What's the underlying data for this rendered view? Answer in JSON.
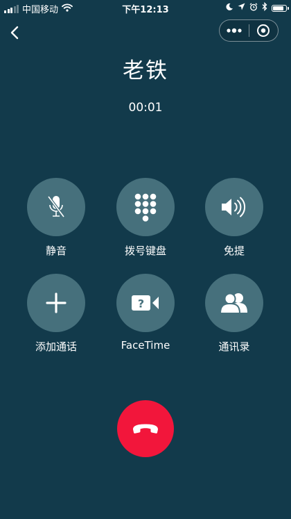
{
  "status_bar": {
    "carrier": "中国移动",
    "time": "下午12:13",
    "signal_bars_active": 3,
    "battery_level": 0.95
  },
  "call": {
    "contact_name": "老铁",
    "duration": "00:01"
  },
  "controls": {
    "mute_label": "静音",
    "keypad_label": "拨号键盘",
    "speaker_label": "免提",
    "add_call_label": "添加通话",
    "facetime_label": "FaceTime",
    "contacts_label": "通讯录"
  },
  "colors": {
    "background": "#123a4b",
    "button_circle": "#46707c",
    "end_call": "#f2163b"
  },
  "icons": [
    "back-icon",
    "more-icon",
    "target-icon",
    "mic-off-icon",
    "keypad-icon",
    "speaker-icon",
    "plus-icon",
    "facetime-icon",
    "contacts-icon",
    "phone-hangup-icon"
  ]
}
